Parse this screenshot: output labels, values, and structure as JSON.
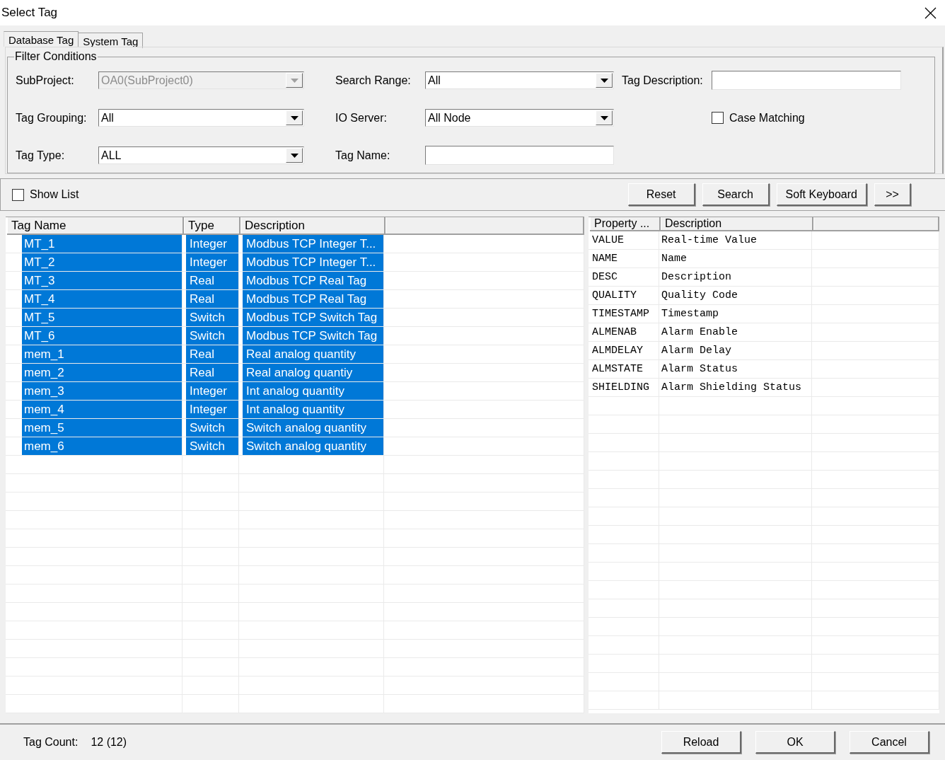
{
  "window": {
    "title": "Select Tag"
  },
  "tabs": [
    {
      "label": "Database Tag",
      "selected": true
    },
    {
      "label": "System Tag",
      "selected": false
    }
  ],
  "filter": {
    "title": "Filter Conditions",
    "rows": [
      [
        {
          "kind": "select",
          "label": "SubProject:",
          "value": "OA0(SubProject0)",
          "disabled": true
        },
        {
          "kind": "select",
          "label": "Search Range:",
          "value": "All",
          "disabled": false
        },
        {
          "kind": "input",
          "label": "Tag Description:"
        }
      ],
      [
        {
          "kind": "select",
          "label": "Tag Grouping:",
          "value": "All",
          "disabled": false
        },
        {
          "kind": "select",
          "label": "IO Server:",
          "value": "All Node",
          "disabled": false
        },
        {
          "kind": "checkbox",
          "label": "Case Matching",
          "checked": false
        }
      ],
      [
        {
          "kind": "select",
          "label": "Tag Type:",
          "value": "ALL",
          "disabled": false
        },
        {
          "kind": "input",
          "label": "Tag Name:"
        }
      ]
    ]
  },
  "toolbar": {
    "show_list": {
      "label": "Show List",
      "checked": false
    },
    "buttons": [
      "Reset",
      "Search",
      "Soft Keyboard",
      ">>"
    ]
  },
  "tag_table": {
    "columns": [
      "Tag Name",
      "Type",
      "Description"
    ],
    "rows": [
      {
        "name": "MT_1",
        "type": "Integer",
        "description": "Modbus TCP Integer T...",
        "selected": true
      },
      {
        "name": "MT_2",
        "type": "Integer",
        "description": "Modbus TCP Integer T...",
        "selected": true
      },
      {
        "name": "MT_3",
        "type": "Real",
        "description": "Modbus TCP Real Tag",
        "selected": true
      },
      {
        "name": "MT_4",
        "type": "Real",
        "description": "Modbus TCP Real Tag",
        "selected": true
      },
      {
        "name": "MT_5",
        "type": "Switch",
        "description": "Modbus TCP Switch Tag",
        "selected": true
      },
      {
        "name": "MT_6",
        "type": "Switch",
        "description": "Modbus TCP Switch Tag",
        "selected": true
      },
      {
        "name": "mem_1",
        "type": "Real",
        "description": "Real analog quantity",
        "selected": true
      },
      {
        "name": "mem_2",
        "type": "Real",
        "description": "Real analog quantiy",
        "selected": true
      },
      {
        "name": "mem_3",
        "type": "Integer",
        "description": "Int analog quantity",
        "selected": true
      },
      {
        "name": "mem_4",
        "type": "Integer",
        "description": "Int analog quantity",
        "selected": true
      },
      {
        "name": "mem_5",
        "type": "Switch",
        "description": "Switch analog quantity",
        "selected": true
      },
      {
        "name": "mem_6",
        "type": "Switch",
        "description": "Switch analog quantity",
        "selected": true
      }
    ]
  },
  "property_table": {
    "columns": [
      "Property ...",
      "Description"
    ],
    "rows": [
      {
        "property": "VALUE",
        "description": "Real-time Value"
      },
      {
        "property": "NAME",
        "description": "Name"
      },
      {
        "property": "DESC",
        "description": "Description"
      },
      {
        "property": "QUALITY",
        "description": "Quality Code"
      },
      {
        "property": "TIMESTAMP",
        "description": "Timestamp"
      },
      {
        "property": "ALMENAB",
        "description": "Alarm Enable"
      },
      {
        "property": "ALMDELAY",
        "description": "Alarm Delay"
      },
      {
        "property": "ALMSTATE",
        "description": "Alarm Status"
      },
      {
        "property": "SHIELDING",
        "description": "Alarm Shielding Status"
      }
    ]
  },
  "footer": {
    "count_label": "Tag Count:",
    "count_value": "12 (12)",
    "buttons": [
      "Reload",
      "OK",
      "Cancel"
    ]
  }
}
